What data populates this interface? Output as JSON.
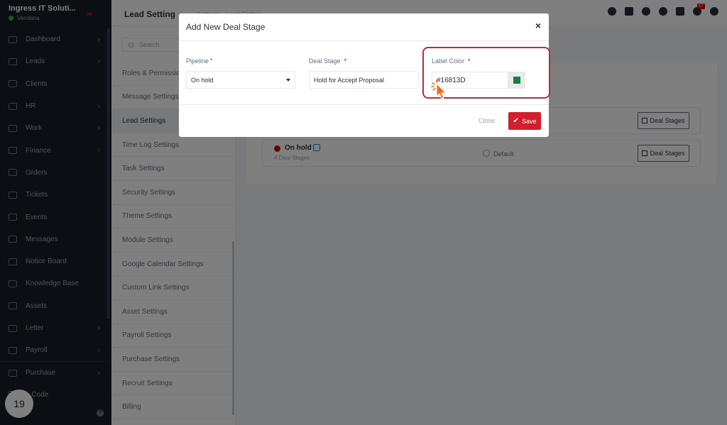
{
  "sidebar": {
    "company": "Ingress IT Soluti...",
    "user": "Vandana",
    "items": [
      {
        "label": "Dashboard",
        "icon": "house-icon",
        "chevron": true
      },
      {
        "label": "Leads",
        "icon": "id-card-icon",
        "chevron": true
      },
      {
        "label": "Clients",
        "icon": "chart-icon",
        "chevron": false
      },
      {
        "label": "HR",
        "icon": "people-icon",
        "chevron": true
      },
      {
        "label": "Work",
        "icon": "briefcase-icon",
        "chevron": true
      },
      {
        "label": "Finance",
        "icon": "dollar-icon",
        "chevron": true
      },
      {
        "label": "Orders",
        "icon": "cart-icon",
        "chevron": false
      },
      {
        "label": "Tickets",
        "icon": "headset-icon",
        "chevron": false
      },
      {
        "label": "Events",
        "icon": "calendar-icon",
        "chevron": false
      },
      {
        "label": "Messages",
        "icon": "chat-icon",
        "chevron": false
      },
      {
        "label": "Notice Board",
        "icon": "clipboard-icon",
        "chevron": false
      },
      {
        "label": "Knowledge Base",
        "icon": "book-icon",
        "chevron": false
      },
      {
        "label": "Assets",
        "icon": "monitor-icon",
        "chevron": false
      },
      {
        "label": "Letter",
        "icon": "envelope-icon",
        "chevron": true
      },
      {
        "label": "Payroll",
        "icon": "wallet-icon",
        "chevron": true
      },
      {
        "label": "Purchase",
        "icon": "receipt-icon",
        "chevron": true
      },
      {
        "label": "...Code",
        "icon": "code-icon",
        "chevron": false
      }
    ],
    "step_badge": "19"
  },
  "header": {
    "title": "Lead Setting",
    "breadcrumb": "Settings · Lead Setting",
    "notification_count": "57"
  },
  "settings_menu": {
    "search_placeholder": "Search",
    "items": [
      "Roles & Permissions",
      "Message Settings",
      "Lead Settings",
      "Time Log Settings",
      "Task Settings",
      "Security Settings",
      "Theme Settings",
      "Module Settings",
      "Google Calendar Settings",
      "Custom Link Settings",
      "Asset Settings",
      "Payroll Settings",
      "Purchase Settings",
      "Recruit Settings",
      "Billing"
    ],
    "active_index": 2
  },
  "pipelines": [
    {
      "name": "",
      "stages": "",
      "default_label": "",
      "button": "Deal Stages"
    },
    {
      "name": "On hold",
      "stages": "4 Deal Stages",
      "default_label": "Default",
      "button": "Deal Stages",
      "color": "#d30000"
    }
  ],
  "modal": {
    "title": "Add New Deal Stage",
    "close_icon": "×",
    "pipeline_label": "Pipeline",
    "pipeline_value": "On hold",
    "deal_stage_label": "Deal Stage",
    "deal_stage_value": "Hold for Accept Proposal",
    "label_color_label": "Label Color",
    "label_color_value": "#16813D",
    "required_mark": "*",
    "close_button": "Close",
    "save_button": "Save",
    "accent_color": "#d21e2d",
    "swatch_color": "#16813D"
  }
}
